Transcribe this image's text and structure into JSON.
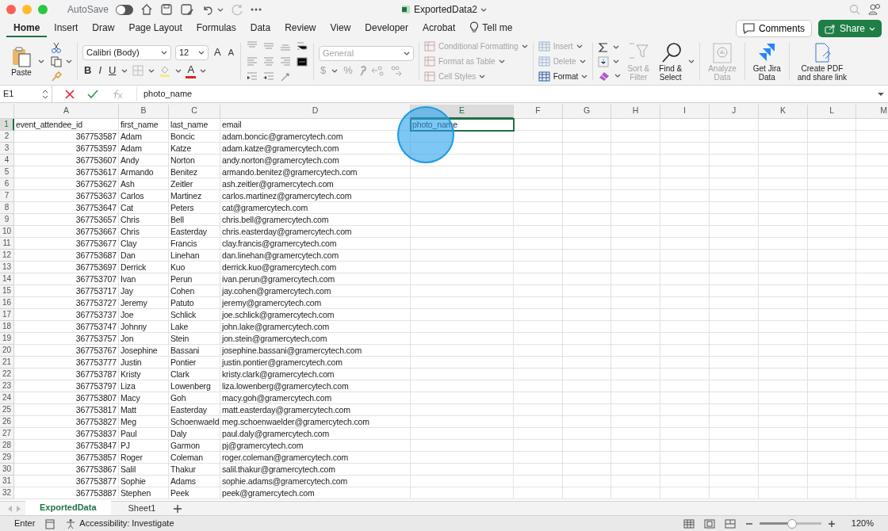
{
  "title_bar": {
    "autosave_label": "AutoSave",
    "autosave_on": false,
    "document_title": "ExportedData2"
  },
  "ribbon_tabs": [
    {
      "label": "Home",
      "selected": true
    },
    {
      "label": "Insert",
      "selected": false
    },
    {
      "label": "Draw",
      "selected": false
    },
    {
      "label": "Page Layout",
      "selected": false
    },
    {
      "label": "Formulas",
      "selected": false
    },
    {
      "label": "Data",
      "selected": false
    },
    {
      "label": "Review",
      "selected": false
    },
    {
      "label": "View",
      "selected": false
    },
    {
      "label": "Developer",
      "selected": false
    },
    {
      "label": "Acrobat",
      "selected": false
    }
  ],
  "tell_me": "Tell me",
  "comments_button": "Comments",
  "share_button": "Share",
  "ribbon": {
    "paste_label": "Paste",
    "font_name": "Calibri (Body)",
    "font_size": "12",
    "grow_font": "A",
    "shrink_font": "A",
    "bold": "B",
    "italic": "I",
    "underline": "U",
    "font_color": "A",
    "number_format": "General",
    "currency": "$",
    "percent": "%",
    "style_commands": [
      {
        "label": "Conditional Formatting",
        "disabled": true
      },
      {
        "label": "Format as Table",
        "disabled": true
      },
      {
        "label": "Cell Styles",
        "disabled": true
      }
    ],
    "cell_commands": [
      {
        "label": "Insert",
        "disabled": true
      },
      {
        "label": "Delete",
        "disabled": true
      },
      {
        "label": "Format",
        "disabled": false
      }
    ],
    "large_commands": [
      {
        "kind": "sort",
        "lines": [
          "Sort &",
          "Filter"
        ],
        "disabled": true
      },
      {
        "kind": "find",
        "lines": [
          "Find &",
          "Select"
        ],
        "disabled": false
      },
      {
        "kind": "analyze",
        "lines": [
          "Analyze",
          "Data"
        ],
        "disabled": true
      },
      {
        "kind": "jira",
        "lines": [
          "Get Jira",
          "Data"
        ],
        "disabled": false
      },
      {
        "kind": "pdf",
        "lines": [
          "Create PDF",
          "and share link"
        ],
        "disabled": false
      }
    ]
  },
  "formula_bar": {
    "name_box": "E1",
    "formula": "photo_name"
  },
  "sheet": {
    "columns": [
      {
        "label": "A",
        "selected": false
      },
      {
        "label": "B",
        "selected": false
      },
      {
        "label": "C",
        "selected": false
      },
      {
        "label": "D",
        "selected": false
      },
      {
        "label": "E",
        "selected": true
      },
      {
        "label": "F",
        "selected": false
      },
      {
        "label": "G",
        "selected": false
      },
      {
        "label": "H",
        "selected": false
      },
      {
        "label": "I",
        "selected": false
      },
      {
        "label": "J",
        "selected": false
      },
      {
        "label": "K",
        "selected": false
      },
      {
        "label": "L",
        "selected": false
      },
      {
        "label": "M",
        "selected": false
      }
    ],
    "rows": [
      {
        "number": "1",
        "selected": true,
        "kind": "header",
        "cells": [
          "event_attendee_id",
          "first_name",
          "last_name",
          "email",
          "photo_name"
        ]
      },
      {
        "number": "2",
        "selected": false,
        "kind": "record",
        "cells": [
          "367753587",
          "Adam",
          "Boncic",
          "adam.boncic@gramercytech.com"
        ]
      },
      {
        "number": "3",
        "selected": false,
        "kind": "record",
        "cells": [
          "367753597",
          "Adam",
          "Katze",
          "adam.katze@gramercytech.com"
        ]
      },
      {
        "number": "4",
        "selected": false,
        "kind": "record",
        "cells": [
          "367753607",
          "Andy",
          "Norton",
          "andy.norton@gramercytech.com"
        ]
      },
      {
        "number": "5",
        "selected": false,
        "kind": "record",
        "cells": [
          "367753617",
          "Armando",
          "Benitez",
          "armando.benitez@gramercytech.com"
        ]
      },
      {
        "number": "6",
        "selected": false,
        "kind": "record",
        "cells": [
          "367753627",
          "Ash",
          "Zeitler",
          "ash.zeitler@gramercytech.com"
        ]
      },
      {
        "number": "7",
        "selected": false,
        "kind": "record",
        "cells": [
          "367753637",
          "Carlos",
          "Martinez",
          "carlos.martinez@gramercytech.com"
        ]
      },
      {
        "number": "8",
        "selected": false,
        "kind": "record",
        "cells": [
          "367753647",
          "Cat",
          "Peters",
          "cat@gramercytech.com"
        ]
      },
      {
        "number": "9",
        "selected": false,
        "kind": "record",
        "cells": [
          "367753657",
          "Chris",
          "Bell",
          "chris.bell@gramercytech.com"
        ]
      },
      {
        "number": "10",
        "selected": false,
        "kind": "record",
        "cells": [
          "367753667",
          "Chris",
          "Easterday",
          "chris.easterday@gramercytech.com"
        ]
      },
      {
        "number": "11",
        "selected": false,
        "kind": "record",
        "cells": [
          "367753677",
          "Clay",
          "Francis",
          "clay.francis@gramercytech.com"
        ]
      },
      {
        "number": "12",
        "selected": false,
        "kind": "record",
        "cells": [
          "367753687",
          "Dan",
          "Linehan",
          "dan.linehan@gramercytech.com"
        ]
      },
      {
        "number": "13",
        "selected": false,
        "kind": "record",
        "cells": [
          "367753697",
          "Derrick",
          "Kuo",
          "derrick.kuo@gramercytech.com"
        ]
      },
      {
        "number": "14",
        "selected": false,
        "kind": "record",
        "cells": [
          "367753707",
          "Ivan",
          "Perun",
          "ivan.perun@gramercytech.com"
        ]
      },
      {
        "number": "15",
        "selected": false,
        "kind": "record",
        "cells": [
          "367753717",
          "Jay",
          "Cohen",
          "jay.cohen@gramercytech.com"
        ]
      },
      {
        "number": "16",
        "selected": false,
        "kind": "record",
        "cells": [
          "367753727",
          "Jeremy",
          "Patuto",
          "jeremy@gramercytech.com"
        ]
      },
      {
        "number": "17",
        "selected": false,
        "kind": "record",
        "cells": [
          "367753737",
          "Joe",
          "Schlick",
          "joe.schlick@gramercytech.com"
        ]
      },
      {
        "number": "18",
        "selected": false,
        "kind": "record",
        "cells": [
          "367753747",
          "Johnny",
          "Lake",
          "john.lake@gramercytech.com"
        ]
      },
      {
        "number": "19",
        "selected": false,
        "kind": "record",
        "cells": [
          "367753757",
          "Jon",
          "Stein",
          "jon.stein@gramercytech.com"
        ]
      },
      {
        "number": "20",
        "selected": false,
        "kind": "record",
        "cells": [
          "367753767",
          "Josephine",
          "Bassani",
          "josephine.bassani@gramercytech.com"
        ]
      },
      {
        "number": "21",
        "selected": false,
        "kind": "record",
        "cells": [
          "367753777",
          "Justin",
          "Pontier",
          "justin.pontier@gramercytech.com"
        ]
      },
      {
        "number": "22",
        "selected": false,
        "kind": "record",
        "cells": [
          "367753787",
          "Kristy",
          "Clark",
          "kristy.clark@gramercytech.com"
        ]
      },
      {
        "number": "23",
        "selected": false,
        "kind": "record",
        "cells": [
          "367753797",
          "Liza",
          "Lowenberg",
          "liza.lowenberg@gramercytech.com"
        ]
      },
      {
        "number": "24",
        "selected": false,
        "kind": "record",
        "cells": [
          "367753807",
          "Macy",
          "Goh",
          "macy.goh@gramercytech.com"
        ]
      },
      {
        "number": "25",
        "selected": false,
        "kind": "record",
        "cells": [
          "367753817",
          "Matt",
          "Easterday",
          "matt.easterday@gramercytech.com"
        ]
      },
      {
        "number": "26",
        "selected": false,
        "kind": "record",
        "cells": [
          "367753827",
          "Meg",
          "Schoenwaeld",
          "meg.schoenwaelder@gramercytech.com"
        ]
      },
      {
        "number": "27",
        "selected": false,
        "kind": "record",
        "cells": [
          "367753837",
          "Paul",
          "Daly",
          "paul.daly@gramercytech.com"
        ]
      },
      {
        "number": "28",
        "selected": false,
        "kind": "record",
        "cells": [
          "367753847",
          "PJ",
          "Garmon",
          "pj@gramercytech.com"
        ]
      },
      {
        "number": "29",
        "selected": false,
        "kind": "record",
        "cells": [
          "367753857",
          "Roger",
          "Coleman",
          "roger.coleman@gramercytech.com"
        ]
      },
      {
        "number": "30",
        "selected": false,
        "kind": "record",
        "cells": [
          "367753867",
          "Salil",
          "Thakur",
          "salil.thakur@gramercytech.com"
        ]
      },
      {
        "number": "31",
        "selected": false,
        "kind": "record",
        "cells": [
          "367753877",
          "Sophie",
          "Adams",
          "sophie.adams@gramercytech.com"
        ]
      },
      {
        "number": "32",
        "selected": false,
        "kind": "record",
        "cells": [
          "367753887",
          "Stephen",
          "Peek",
          "peek@gramercytech.com"
        ]
      }
    ]
  },
  "sheet_tabs": [
    {
      "label": "ExportedData",
      "selected": true
    },
    {
      "label": "Sheet1",
      "selected": false
    }
  ],
  "status_bar": {
    "mode": "Enter",
    "accessibility": "Accessibility: Investigate",
    "zoom_slider": {
      "level": 0.53
    },
    "zoom": "120%"
  }
}
